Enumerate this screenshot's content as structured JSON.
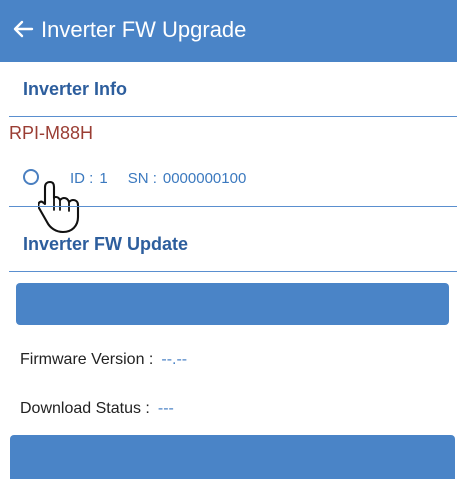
{
  "header": {
    "title": "Inverter FW Upgrade"
  },
  "inverter_info": {
    "heading": "Inverter Info",
    "model": "RPI-M88H",
    "device": {
      "id_label": "ID :",
      "id_value": "1",
      "sn_label": "SN :",
      "sn_value": "0000000100",
      "selected": false
    }
  },
  "firmware_update": {
    "heading": "Inverter FW Update",
    "firmware_version_label": "Firmware Version :",
    "firmware_version_value": "--.--",
    "download_status_label": "Download Status :",
    "download_status_value": "---"
  },
  "colors": {
    "header": "#4a84c7",
    "heading": "#2d5e9d",
    "model": "#9a3d33",
    "value": "#4b82c5"
  },
  "icons": {
    "back": "arrow-left-icon",
    "radio": "radio-button-icon",
    "hand": "pointing-hand-icon"
  }
}
